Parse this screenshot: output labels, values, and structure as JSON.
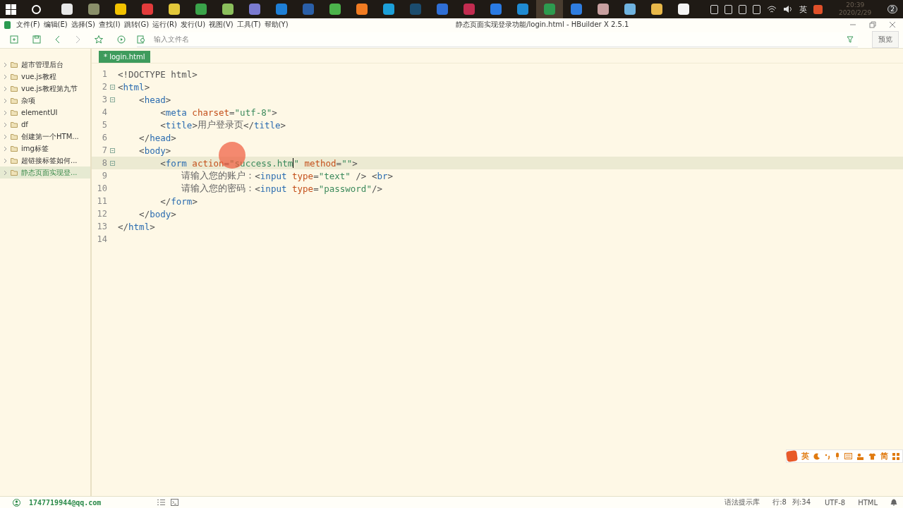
{
  "taskbar": {
    "apps": [
      {
        "color": "#e8e8e8",
        "selected": false
      },
      {
        "color": "#8a8f6a",
        "selected": false
      },
      {
        "color": "#f2c200",
        "selected": false
      },
      {
        "color": "#e23b3b",
        "selected": false
      },
      {
        "color": "#e2c83a",
        "selected": false
      },
      {
        "color": "#3aa34a",
        "selected": false
      },
      {
        "color": "#8bbf5c",
        "selected": false
      },
      {
        "color": "#7a7ad0",
        "selected": false
      },
      {
        "color": "#1e7fd6",
        "selected": false
      },
      {
        "color": "#2a5fa8",
        "selected": false
      },
      {
        "color": "#4bb34b",
        "selected": false
      },
      {
        "color": "#f07b22",
        "selected": false
      },
      {
        "color": "#1c9fd8",
        "selected": false
      },
      {
        "color": "#1b4c6e",
        "selected": false
      },
      {
        "color": "#2f6fd6",
        "selected": false
      },
      {
        "color": "#c22c50",
        "selected": false
      },
      {
        "color": "#2a7ae2",
        "selected": false
      },
      {
        "color": "#1f8ad2",
        "selected": false
      },
      {
        "color": "#2d9b4f",
        "selected": true
      },
      {
        "color": "#2f7de0",
        "selected": false
      },
      {
        "color": "#c8a0a0",
        "selected": false
      },
      {
        "color": "#6fb3e0",
        "selected": false
      },
      {
        "color": "#e8b84a",
        "selected": false
      },
      {
        "color": "#f4f4f4",
        "selected": false
      }
    ],
    "ime": "英",
    "time": "20:39",
    "date": "2020/2/29",
    "notifications": "2"
  },
  "menubar": {
    "items": [
      "文件(F)",
      "编辑(E)",
      "选择(S)",
      "查找(I)",
      "跳转(G)",
      "运行(R)",
      "发行(U)",
      "视图(V)",
      "工具(T)",
      "帮助(Y)"
    ],
    "title": "静态页面实现登录功能/login.html - HBuilder X 2.5.1"
  },
  "toolbar": {
    "search": {
      "placeholder": "输入文件名"
    },
    "preview": "预览"
  },
  "sidebar": {
    "items": [
      {
        "label": "超市管理后台",
        "selected": false
      },
      {
        "label": "vue.js教程",
        "selected": false
      },
      {
        "label": "vue.js教程第九节",
        "selected": false
      },
      {
        "label": "杂项",
        "selected": false
      },
      {
        "label": "elementUI",
        "selected": false
      },
      {
        "label": "df",
        "selected": false
      },
      {
        "label": "创建第一个HTM...",
        "selected": false
      },
      {
        "label": "img标签",
        "selected": false
      },
      {
        "label": "超链接标签如何...",
        "selected": false
      },
      {
        "label": "静态页面实现登...",
        "selected": true
      }
    ]
  },
  "tabs": [
    {
      "label": "* login.html",
      "selected": true
    }
  ],
  "editor": {
    "lines": [
      {
        "num": "1",
        "fold": false,
        "current": false,
        "tokens": [
          {
            "kind": "punct",
            "text": "<!DOCTYPE html>"
          }
        ]
      },
      {
        "num": "2",
        "fold": true,
        "current": false,
        "tokens": [
          {
            "kind": "punct",
            "text": "<"
          },
          {
            "kind": "tag",
            "text": "html"
          },
          {
            "kind": "punct",
            "text": ">"
          }
        ]
      },
      {
        "num": "3",
        "fold": true,
        "current": false,
        "tokens": [
          {
            "kind": "punct",
            "text": "    <"
          },
          {
            "kind": "tag",
            "text": "head"
          },
          {
            "kind": "punct",
            "text": ">"
          }
        ]
      },
      {
        "num": "4",
        "fold": false,
        "current": false,
        "tokens": [
          {
            "kind": "punct",
            "text": "        <"
          },
          {
            "kind": "tag",
            "text": "meta"
          },
          {
            "kind": "attr",
            "text": " charset"
          },
          {
            "kind": "punct",
            "text": "="
          },
          {
            "kind": "str",
            "text": "\"utf-8\""
          },
          {
            "kind": "punct",
            "text": ">"
          }
        ]
      },
      {
        "num": "5",
        "fold": false,
        "current": false,
        "tokens": [
          {
            "kind": "punct",
            "text": "        <"
          },
          {
            "kind": "tag",
            "text": "title"
          },
          {
            "kind": "punct",
            "text": ">"
          },
          {
            "kind": "text",
            "text": "用户登录页"
          },
          {
            "kind": "punct",
            "text": "</"
          },
          {
            "kind": "tag",
            "text": "title"
          },
          {
            "kind": "punct",
            "text": ">"
          }
        ]
      },
      {
        "num": "6",
        "fold": false,
        "current": false,
        "tokens": [
          {
            "kind": "punct",
            "text": "    </"
          },
          {
            "kind": "tag",
            "text": "head"
          },
          {
            "kind": "punct",
            "text": ">"
          }
        ]
      },
      {
        "num": "7",
        "fold": true,
        "current": false,
        "tokens": [
          {
            "kind": "punct",
            "text": "    <"
          },
          {
            "kind": "tag",
            "text": "body"
          },
          {
            "kind": "punct",
            "text": ">"
          }
        ]
      },
      {
        "num": "8",
        "fold": true,
        "current": true,
        "tokens": [
          {
            "kind": "punct",
            "text": "        <"
          },
          {
            "kind": "tag",
            "text": "form"
          },
          {
            "kind": "attr",
            "text": " action"
          },
          {
            "kind": "punct",
            "text": "="
          },
          {
            "kind": "str",
            "text": "\"success.htm"
          },
          {
            "kind": "caret"
          },
          {
            "kind": "str",
            "text": "\""
          },
          {
            "kind": "attr",
            "text": " method"
          },
          {
            "kind": "punct",
            "text": "="
          },
          {
            "kind": "str",
            "text": "\"\""
          },
          {
            "kind": "punct",
            "text": ">"
          }
        ]
      },
      {
        "num": "9",
        "fold": false,
        "current": false,
        "tokens": [
          {
            "kind": "text",
            "text": "            请输入您的账户："
          },
          {
            "kind": "punct",
            "text": "<"
          },
          {
            "kind": "tag",
            "text": "input"
          },
          {
            "kind": "attr",
            "text": " type"
          },
          {
            "kind": "punct",
            "text": "="
          },
          {
            "kind": "str",
            "text": "\"text\""
          },
          {
            "kind": "punct",
            "text": " /> <"
          },
          {
            "kind": "tag",
            "text": "br"
          },
          {
            "kind": "punct",
            "text": ">"
          }
        ]
      },
      {
        "num": "10",
        "fold": false,
        "current": false,
        "tokens": [
          {
            "kind": "text",
            "text": "            请输入您的密码："
          },
          {
            "kind": "punct",
            "text": "<"
          },
          {
            "kind": "tag",
            "text": "input"
          },
          {
            "kind": "attr",
            "text": " type"
          },
          {
            "kind": "punct",
            "text": "="
          },
          {
            "kind": "str",
            "text": "\"password\""
          },
          {
            "kind": "punct",
            "text": "/>"
          }
        ]
      },
      {
        "num": "11",
        "fold": false,
        "current": false,
        "tokens": [
          {
            "kind": "punct",
            "text": "        </"
          },
          {
            "kind": "tag",
            "text": "form"
          },
          {
            "kind": "punct",
            "text": ">"
          }
        ]
      },
      {
        "num": "12",
        "fold": false,
        "current": false,
        "tokens": [
          {
            "kind": "punct",
            "text": "    </"
          },
          {
            "kind": "tag",
            "text": "body"
          },
          {
            "kind": "punct",
            "text": ">"
          }
        ]
      },
      {
        "num": "13",
        "fold": false,
        "current": false,
        "tokens": [
          {
            "kind": "punct",
            "text": "</"
          },
          {
            "kind": "tag",
            "text": "html"
          },
          {
            "kind": "punct",
            "text": ">"
          }
        ]
      },
      {
        "num": "14",
        "fold": false,
        "current": false
      }
    ]
  },
  "ime_bar": {
    "mode": "英",
    "script": "简"
  },
  "status_bar": {
    "account": "1747719944@qq.com",
    "syntax": "语法提示库",
    "line": "行:8",
    "column": "列:34",
    "encoding": "UTF-8",
    "language": "HTML"
  }
}
